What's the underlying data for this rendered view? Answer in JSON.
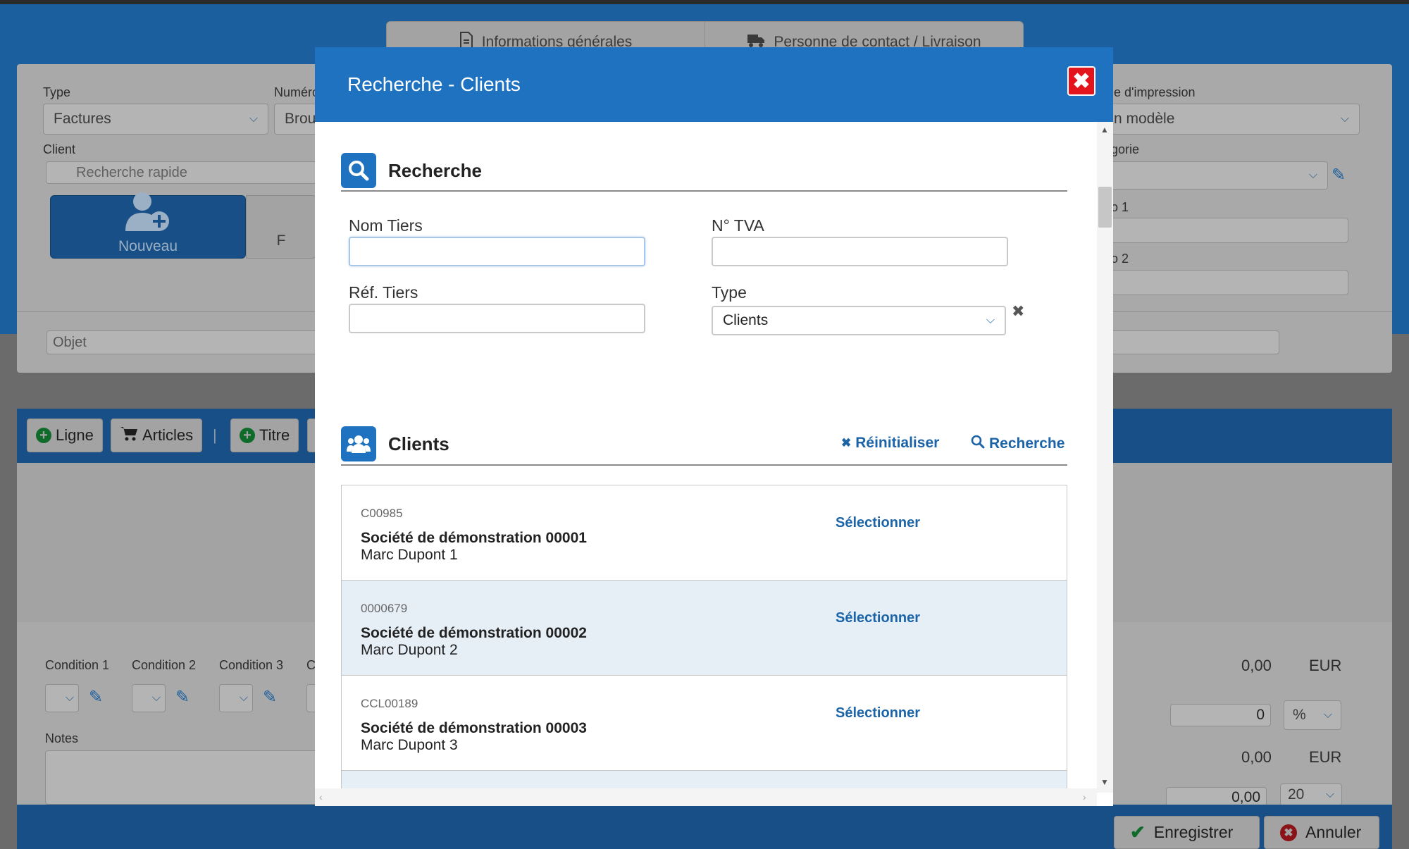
{
  "background": {
    "tabs": [
      "Informations générales",
      "Personne de contact / Livraison"
    ],
    "type_label": "Type",
    "type_value": "Factures",
    "numero_label": "Numéro",
    "numero_value": "Broui",
    "client_label": "Client",
    "client_placeholder": "Recherche rapide",
    "nouveau_label": "Nouveau",
    "second_button_partial": "F",
    "objet_placeholder": "Objet",
    "modele_label": "le d'impression",
    "modele_value": "n modèle",
    "categorie_label": "gorie",
    "info1_label": "o 1",
    "info2_label": "o 2",
    "toolbar": {
      "ligne": "Ligne",
      "articles": "Articles",
      "separator": "|",
      "titre": "Titre"
    },
    "conditions": [
      "Condition 1",
      "Condition 2",
      "Condition 3",
      "C"
    ],
    "notes_label": "Notes",
    "totals": {
      "amount1": "0,00",
      "currency1": "EUR",
      "discount_value": "0",
      "discount_unit": "%",
      "amount2": "0,00",
      "currency2": "EUR",
      "amount3": "0,00",
      "tax_value": "20"
    },
    "footer": {
      "save": "Enregistrer",
      "cancel": "Annuler"
    }
  },
  "modal": {
    "title": "Recherche - Clients",
    "search_section": "Recherche",
    "fields": {
      "nom_tiers": {
        "label": "Nom Tiers",
        "value": ""
      },
      "tva": {
        "label": "N° TVA",
        "value": ""
      },
      "ref_tiers": {
        "label": "Réf. Tiers",
        "value": ""
      },
      "type": {
        "label": "Type",
        "value": "Clients"
      }
    },
    "reset_label": "Réinitialiser",
    "search_label": "Recherche",
    "results_section": "Clients",
    "results": [
      {
        "code": "C00985",
        "name": "Société de démonstration 00001",
        "contact": "Marc Dupont 1",
        "action": "Sélectionner"
      },
      {
        "code": "0000679",
        "name": "Société de démonstration 00002",
        "contact": "Marc Dupont 2",
        "action": "Sélectionner"
      },
      {
        "code": "CCL00189",
        "name": "Société de démonstration 00003",
        "contact": "Marc Dupont 3",
        "action": "Sélectionner"
      }
    ]
  },
  "colors": {
    "primary": "#1e72c0",
    "close": "#e3141b",
    "link": "#1c64a8",
    "row_alt": "#e6eef6"
  }
}
